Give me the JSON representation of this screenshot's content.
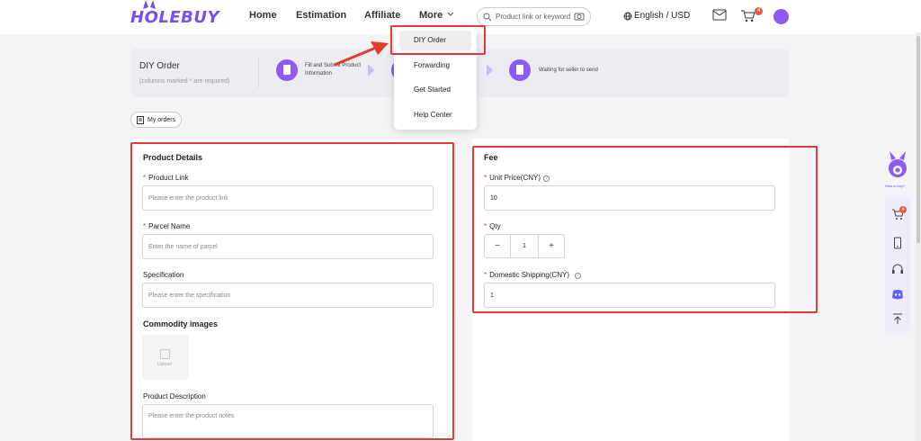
{
  "header": {
    "logo": "HOLEBUY",
    "nav": [
      {
        "label": "Home"
      },
      {
        "label": "Estimation"
      },
      {
        "label": "Affiliate"
      },
      {
        "label": "More"
      }
    ],
    "search_placeholder": "Product link or keyword",
    "language": "English / USD",
    "cart_count": "4"
  },
  "more_menu": {
    "items": [
      "DIY Order",
      "Forwarding",
      "Get Started",
      "Help Center"
    ],
    "active": "DIY Order"
  },
  "steps": {
    "title": "DIY Order",
    "subtitle": "(columns marked * are required)",
    "items": [
      {
        "text_line1": "Fill and Submit Product",
        "text_line2": "Information"
      },
      {
        "text_line1": "",
        "text_line2": ""
      },
      {
        "text_line1": "Waiting for seller to send",
        "text_line2": ""
      }
    ]
  },
  "my_orders": "My orders",
  "product_details": {
    "title": "Product Details",
    "product_link": {
      "label": "Product Link",
      "placeholder": "Please enter the product link"
    },
    "parcel_name": {
      "label": "Parcel Name",
      "placeholder": "Enter the name of parcel"
    },
    "specification": {
      "label": "Specification",
      "placeholder": "Please enter the specification"
    },
    "images": {
      "label": "Commodity images",
      "upload": "Upload"
    },
    "description": {
      "label": "Product Description",
      "placeholder": "Please enter the product notes"
    }
  },
  "fee": {
    "title": "Fee",
    "unit_price": {
      "label": "Unit Price(CNY)",
      "value": "10"
    },
    "qty": {
      "label": "Qty",
      "value": "1",
      "minus": "−",
      "plus": "+"
    },
    "domestic_shipping": {
      "label": "Domestic Shipping(CNY)",
      "value": "1"
    }
  },
  "float_bar": {
    "mascot_label": "How to buy?",
    "cart_count": "4"
  },
  "colors": {
    "brand": "#8c5bf5",
    "highlight_red": "#e53935",
    "badge": "#f0573a"
  }
}
